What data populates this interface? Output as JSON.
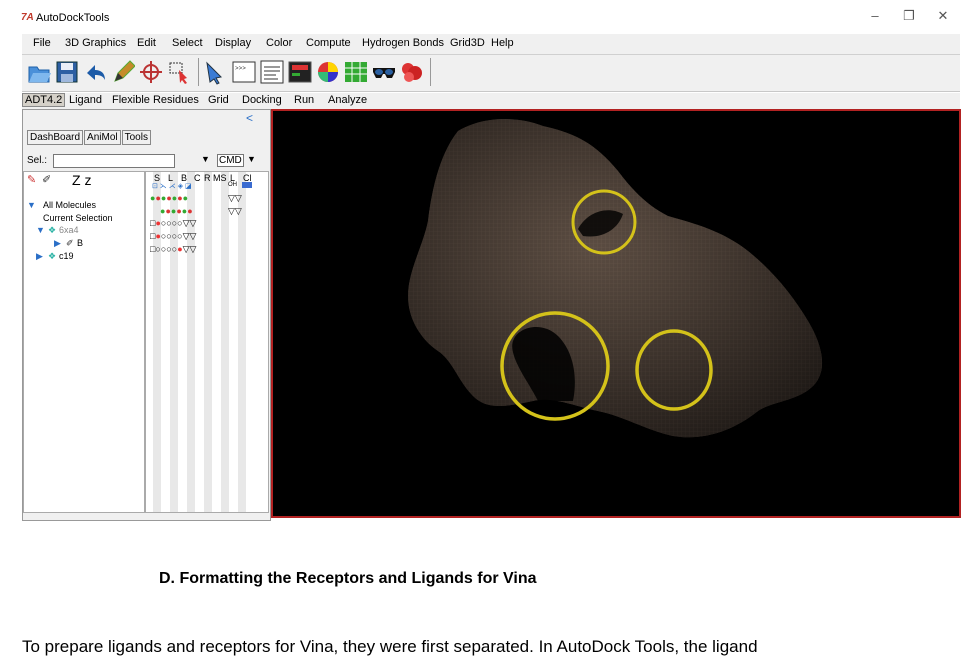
{
  "window": {
    "title": "AutoDockTools",
    "icon": "autodocktools-icon",
    "minimize": "–",
    "maximize": "❐",
    "close": "✕"
  },
  "menu": [
    "File",
    "3D Graphics",
    "Edit",
    "Select",
    "Display",
    "Color",
    "Compute",
    "Hydrogen Bonds",
    "Grid3D",
    "Help"
  ],
  "toolbar": {
    "icons": [
      "open-folder-icon",
      "save-icon",
      "undo-icon",
      "pencil-icon",
      "center-target-icon",
      "select-icon",
      "pointer-icon",
      "python-shell-icon",
      "text-lines-icon",
      "monitor-icon",
      "color-ball-icon",
      "grid-display-icon",
      "stereo-glasses-icon",
      "surface-molecule-icon"
    ]
  },
  "modules": [
    "ADT4.2",
    "Ligand",
    "Flexible Residues",
    "Grid",
    "Docking",
    "Run",
    "Analyze"
  ],
  "left_panel": {
    "tabs": [
      "DashBoard",
      "AniMol",
      "Tools"
    ],
    "sel_label": "Sel.:",
    "sel_value": "",
    "cmd_label": "CMD",
    "tree_toolbar": "Z z",
    "tree": [
      "All Molecules",
      "Current Selection",
      "6xa4",
      "B",
      "c19"
    ],
    "columns": [
      "S",
      "L",
      "B",
      "C",
      "R",
      "MS",
      "L",
      "Cl"
    ],
    "col_sub": [
      "OH"
    ]
  },
  "viewer": {
    "background": "#000000",
    "border_color": "#b22222",
    "surface_color": "#5a4a40",
    "circle_color": "#d4c21a"
  },
  "document": {
    "heading": "D.   Formatting the Receptors and Ligands for Vina",
    "paragraph": "To prepare ligands and receptors for Vina, they were first separated. In AutoDock Tools, the ligand"
  }
}
